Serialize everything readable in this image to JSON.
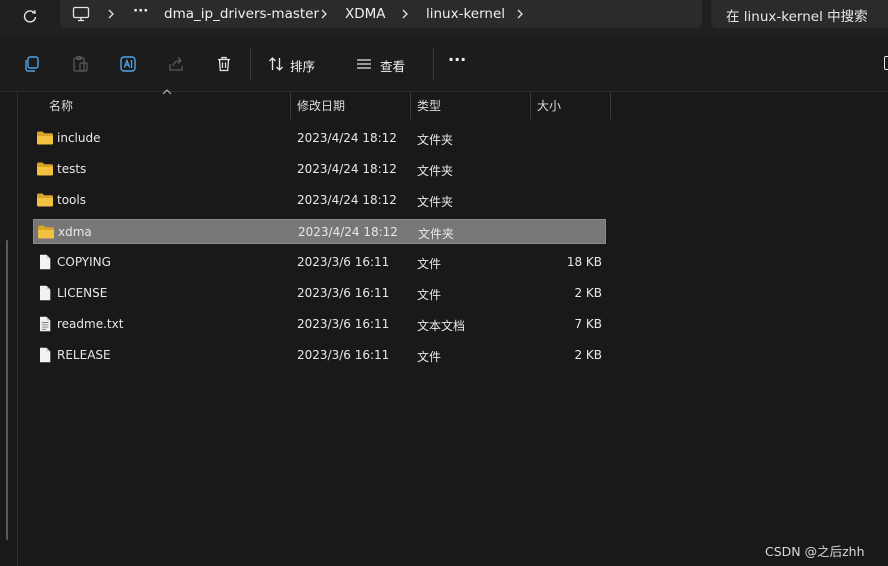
{
  "address": {
    "more": "···",
    "crumbs": [
      "dma_ip_drivers-master",
      "XDMA",
      "linux-kernel"
    ]
  },
  "search": {
    "placeholder": "在 linux-kernel 中搜索"
  },
  "toolbar": {
    "sort_label": "排序",
    "view_label": "查看",
    "more": "···"
  },
  "columns": {
    "name": "名称",
    "modified": "修改日期",
    "type": "类型",
    "size": "大小"
  },
  "files": [
    {
      "name": "include",
      "modified": "2023/4/24 18:12",
      "type": "文件夹",
      "size": "",
      "icon": "folder-icon"
    },
    {
      "name": "tests",
      "modified": "2023/4/24 18:12",
      "type": "文件夹",
      "size": "",
      "icon": "folder-icon"
    },
    {
      "name": "tools",
      "modified": "2023/4/24 18:12",
      "type": "文件夹",
      "size": "",
      "icon": "folder-icon"
    },
    {
      "name": "xdma",
      "modified": "2023/4/24 18:12",
      "type": "文件夹",
      "size": "",
      "icon": "folder-icon",
      "selected": true
    },
    {
      "name": "COPYING",
      "modified": "2023/3/6 16:11",
      "type": "文件",
      "size": "18 KB",
      "icon": "file-icon"
    },
    {
      "name": "LICENSE",
      "modified": "2023/3/6 16:11",
      "type": "文件",
      "size": "2 KB",
      "icon": "file-icon"
    },
    {
      "name": "readme.txt",
      "modified": "2023/3/6 16:11",
      "type": "文本文档",
      "size": "7 KB",
      "icon": "text-file-icon"
    },
    {
      "name": "RELEASE",
      "modified": "2023/3/6 16:11",
      "type": "文件",
      "size": "2 KB",
      "icon": "file-icon"
    }
  ],
  "watermark": "CSDN @之后zhh",
  "colors": {
    "folder": "#f4c042",
    "selection": "#777777",
    "background": "#191919"
  }
}
